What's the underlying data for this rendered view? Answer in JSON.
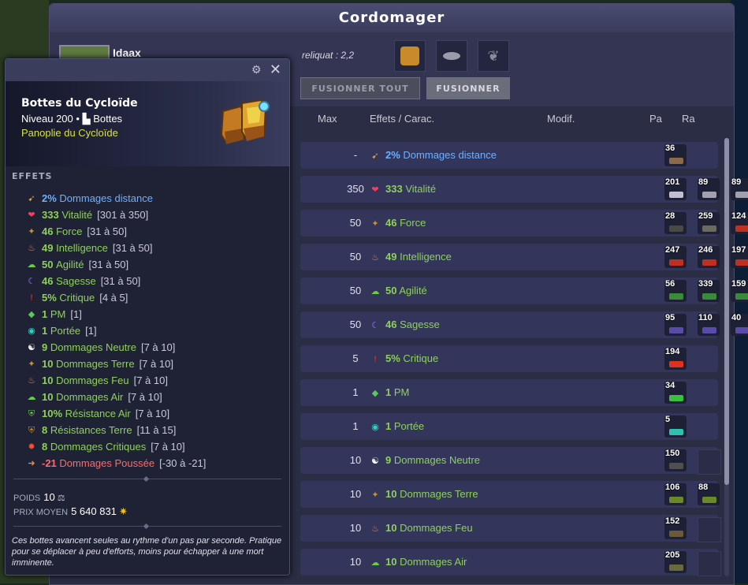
{
  "window": {
    "title": "Cordomager",
    "character_name": "Idaax",
    "reliquat": "reliquat : 2,2",
    "btn_fuse_all": "FUSIONNER TOUT",
    "btn_fuse": "FUSIONNER",
    "columns": {
      "max": "Max",
      "effects": "Effets / Carac.",
      "modif": "Modif.",
      "pa": "Pa",
      "ra": "Ra"
    }
  },
  "rows": [
    {
      "max": "-",
      "val": "2%",
      "label": "Dommages distance",
      "color": "#6fb0ff",
      "icon": "bow-icon",
      "runes": [
        "36"
      ]
    },
    {
      "max": "350",
      "val": "333",
      "label": "Vitalité",
      "color": "#8ed05a",
      "icon": "heart-icon",
      "runes": [
        "201",
        "89",
        "89"
      ]
    },
    {
      "max": "50",
      "val": "46",
      "label": "Force",
      "color": "#8ed05a",
      "icon": "earth-icon",
      "runes": [
        "28",
        "259",
        "124"
      ]
    },
    {
      "max": "50",
      "val": "49",
      "label": "Intelligence",
      "color": "#8ed05a",
      "icon": "fire-icon",
      "runes": [
        "247",
        "246",
        "197"
      ]
    },
    {
      "max": "50",
      "val": "50",
      "label": "Agilité",
      "color": "#8ed05a",
      "icon": "air-icon",
      "runes": [
        "56",
        "339",
        "159"
      ]
    },
    {
      "max": "50",
      "val": "46",
      "label": "Sagesse",
      "color": "#8ed05a",
      "icon": "wisdom-icon",
      "runes": [
        "95",
        "110",
        "40"
      ]
    },
    {
      "max": "5",
      "val": "5%",
      "label": "Critique",
      "color": "#8ed05a",
      "icon": "critical-icon",
      "runes": [
        "194"
      ]
    },
    {
      "max": "1",
      "val": "1",
      "label": "PM",
      "color": "#8ed05a",
      "icon": "mp-icon",
      "runes": [
        "34"
      ]
    },
    {
      "max": "1",
      "val": "1",
      "label": "Portée",
      "color": "#8ed05a",
      "icon": "range-icon",
      "runes": [
        "5"
      ]
    },
    {
      "max": "10",
      "val": "9",
      "label": "Dommages Neutre",
      "color": "#8ed05a",
      "icon": "neutral-icon",
      "runes": [
        "150",
        ""
      ]
    },
    {
      "max": "10",
      "val": "10",
      "label": "Dommages Terre",
      "color": "#8ed05a",
      "icon": "earth-icon",
      "runes": [
        "106",
        "88"
      ]
    },
    {
      "max": "10",
      "val": "10",
      "label": "Dommages Feu",
      "color": "#8ed05a",
      "icon": "fire-icon",
      "runes": [
        "152",
        ""
      ]
    },
    {
      "max": "10",
      "val": "10",
      "label": "Dommages Air",
      "color": "#8ed05a",
      "icon": "air-icon",
      "runes": [
        "205",
        ""
      ]
    }
  ],
  "tooltip": {
    "name": "Bottes du Cycloïde",
    "level": "Niveau 200",
    "type": "Bottes",
    "set": "Panoplie du Cycloïde",
    "effects_title": "EFFETS",
    "effects": [
      {
        "val": "2%",
        "label": "Dommages distance",
        "range": "",
        "color": "#6fb0ff",
        "icon": "bow-icon"
      },
      {
        "val": "333",
        "label": "Vitalité",
        "range": "[301 à 350]",
        "color": "#8ed05a",
        "icon": "heart-icon"
      },
      {
        "val": "46",
        "label": "Force",
        "range": "[31 à 50]",
        "color": "#8ed05a",
        "icon": "earth-icon"
      },
      {
        "val": "49",
        "label": "Intelligence",
        "range": "[31 à 50]",
        "color": "#8ed05a",
        "icon": "fire-icon"
      },
      {
        "val": "50",
        "label": "Agilité",
        "range": "[31 à 50]",
        "color": "#8ed05a",
        "icon": "air-icon"
      },
      {
        "val": "46",
        "label": "Sagesse",
        "range": "[31 à 50]",
        "color": "#8ed05a",
        "icon": "wisdom-icon"
      },
      {
        "val": "5%",
        "label": "Critique",
        "range": "[4 à 5]",
        "color": "#8ed05a",
        "icon": "critical-icon"
      },
      {
        "val": "1",
        "label": "PM",
        "range": "[1]",
        "color": "#8ed05a",
        "icon": "mp-icon"
      },
      {
        "val": "1",
        "label": "Portée",
        "range": "[1]",
        "color": "#8ed05a",
        "icon": "range-icon"
      },
      {
        "val": "9",
        "label": "Dommages Neutre",
        "range": "[7 à 10]",
        "color": "#8ed05a",
        "icon": "neutral-icon"
      },
      {
        "val": "10",
        "label": "Dommages Terre",
        "range": "[7 à 10]",
        "color": "#8ed05a",
        "icon": "earth-icon"
      },
      {
        "val": "10",
        "label": "Dommages Feu",
        "range": "[7 à 10]",
        "color": "#8ed05a",
        "icon": "fire-icon"
      },
      {
        "val": "10",
        "label": "Dommages Air",
        "range": "[7 à 10]",
        "color": "#8ed05a",
        "icon": "air-icon"
      },
      {
        "val": "10%",
        "label": "Résistance Air",
        "range": "[7 à 10]",
        "color": "#8ed05a",
        "icon": "air-resist-icon"
      },
      {
        "val": "8",
        "label": "Résistances Terre",
        "range": "[11 à 15]",
        "color": "#8ed05a",
        "icon": "earth-resist-icon"
      },
      {
        "val": "8",
        "label": "Dommages Critiques",
        "range": "[7 à 10]",
        "color": "#8ed05a",
        "icon": "crit-damage-icon"
      },
      {
        "val": "-21",
        "label": "Dommages Poussée",
        "range": "[-30 à -21]",
        "color": "#ff6a6a",
        "icon": "push-icon"
      }
    ],
    "weight_label": "POIDS",
    "weight": "10",
    "price_label": "PRIX MOYEN",
    "price": "5 640 831",
    "description": "Ces bottes avancent seules au rythme d'un pas par seconde. Pratique pour se déplacer à peu d'efforts, moins pour échapper à une mort imminente."
  }
}
